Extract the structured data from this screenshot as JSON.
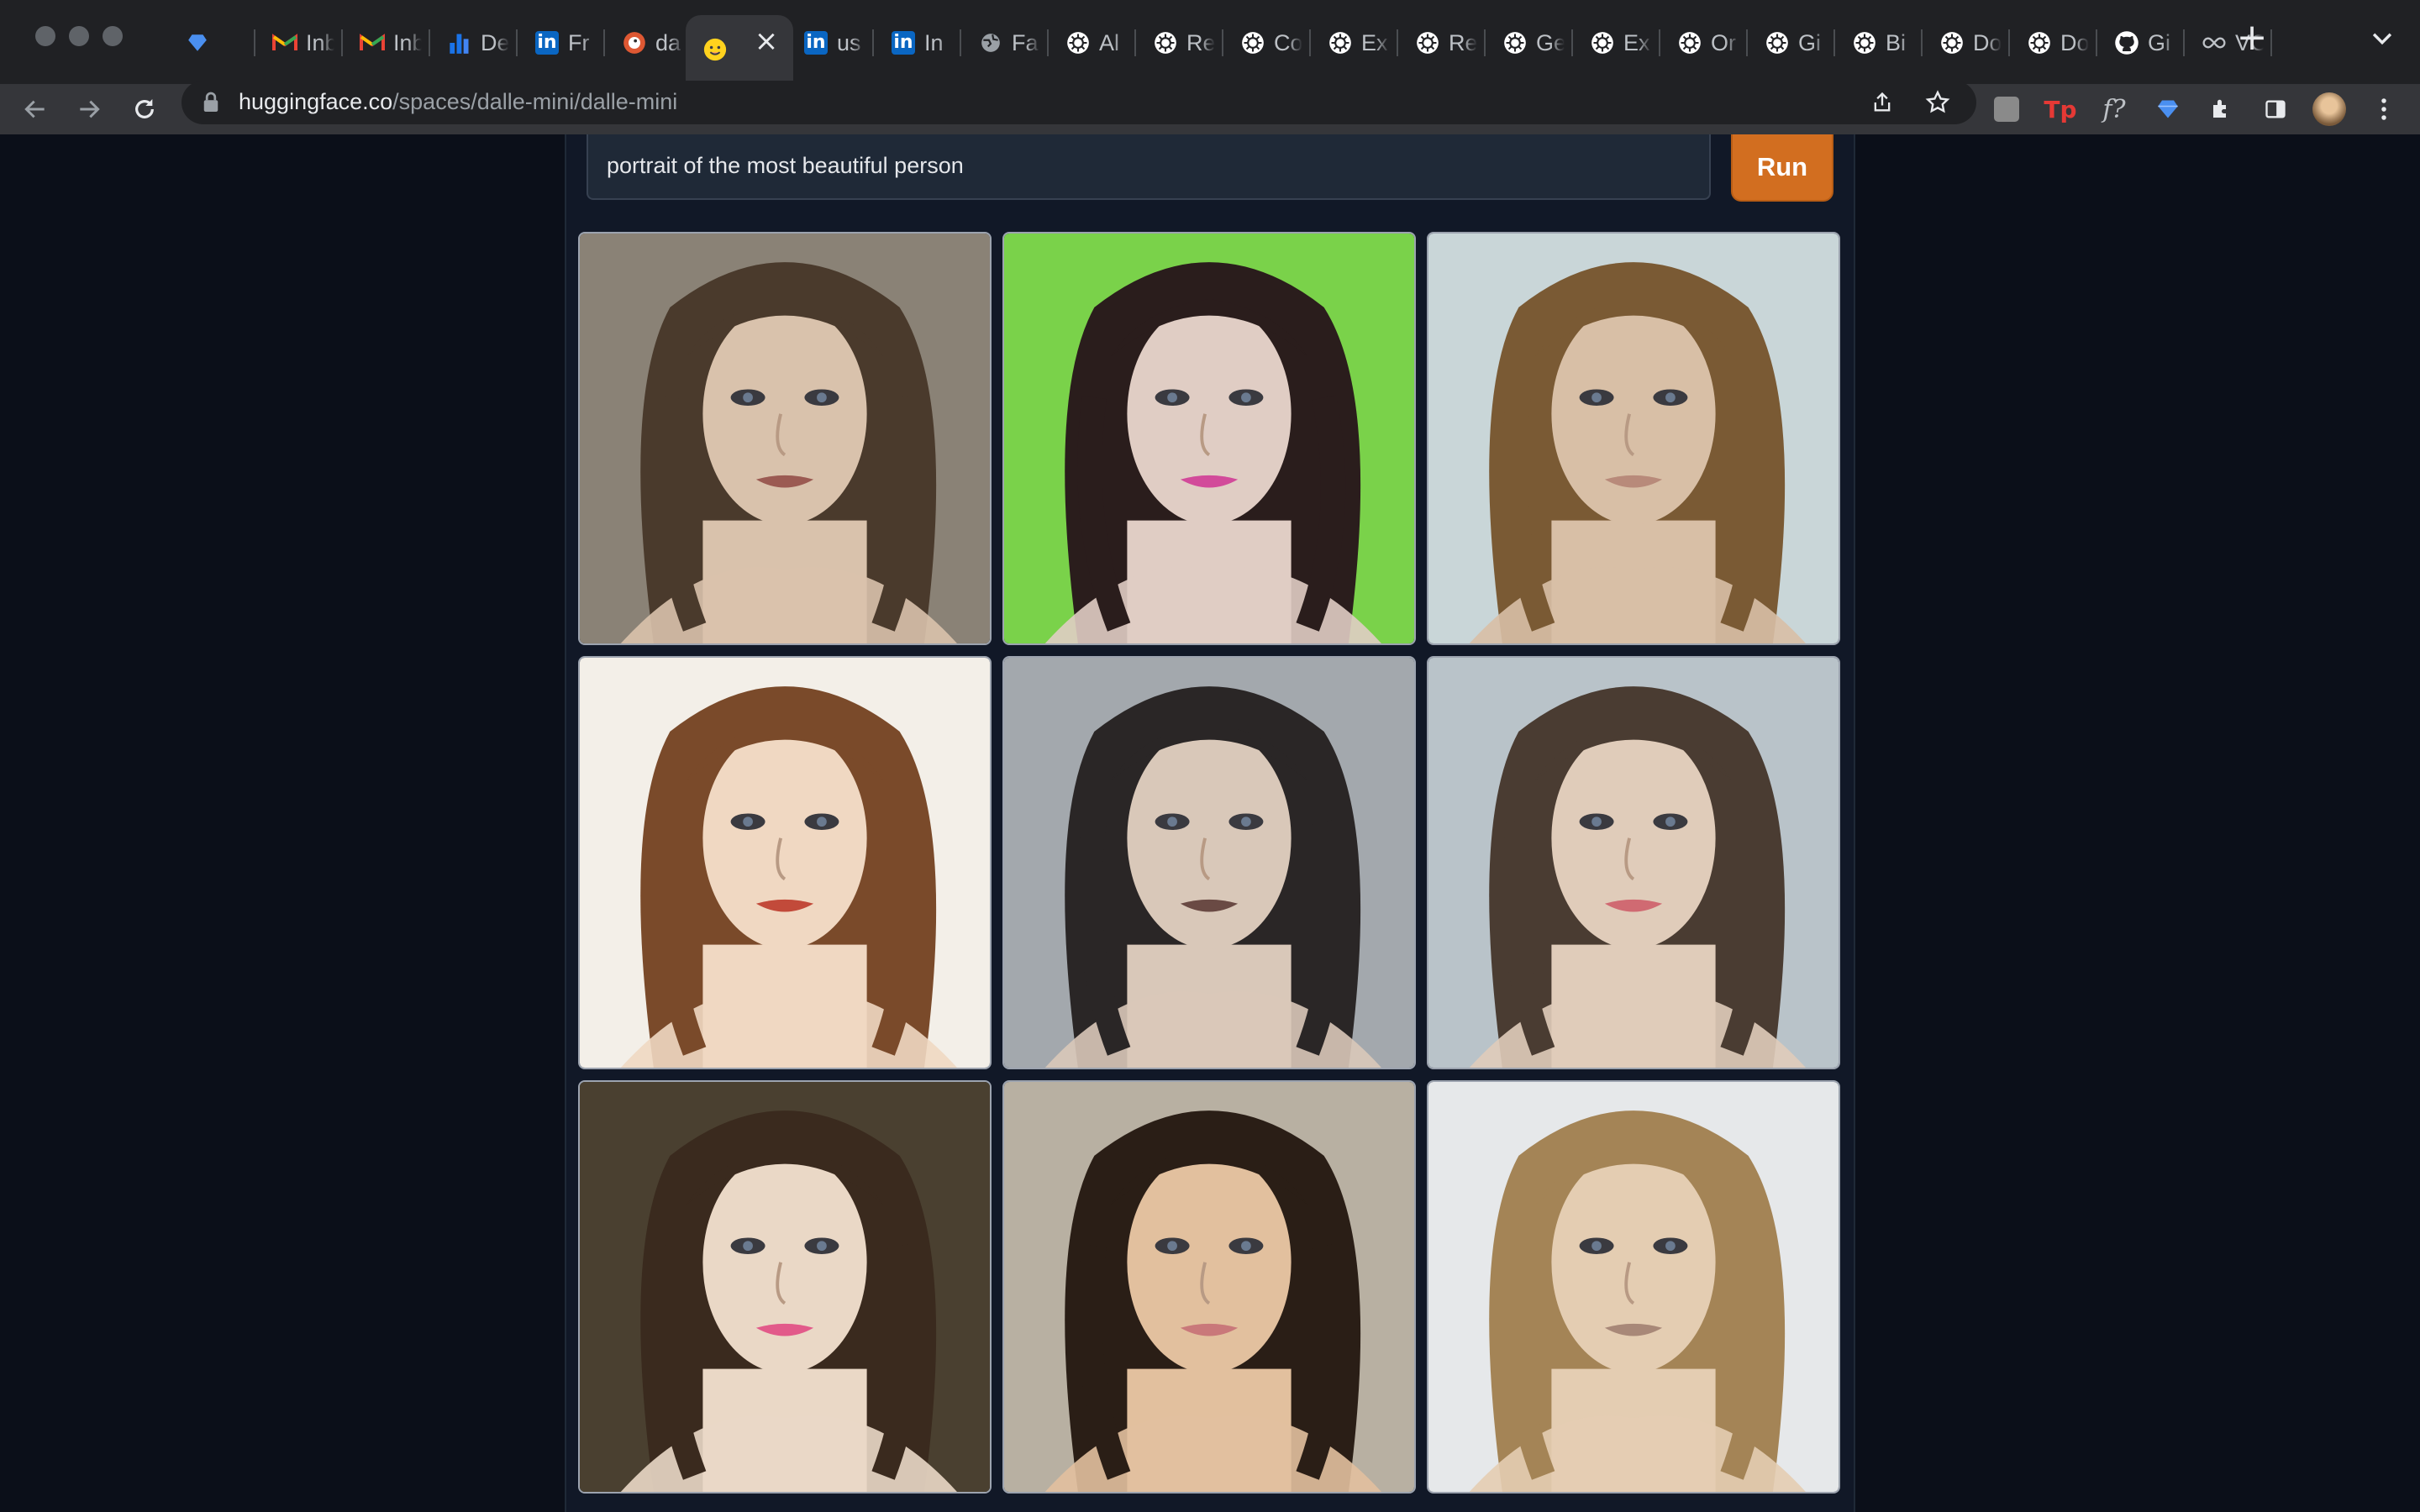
{
  "browser": {
    "tabs": [
      {
        "title": "",
        "icon": "gem-icon"
      },
      {
        "title": "Inbox",
        "icon": "gmail-icon"
      },
      {
        "title": "Inbox",
        "icon": "gmail-icon"
      },
      {
        "title": "De",
        "icon": "bar-chart-icon"
      },
      {
        "title": "Fr",
        "icon": "linkedin-icon"
      },
      {
        "title": "da",
        "icon": "duckduckgo-icon"
      },
      {
        "title": "",
        "icon": "hugging-face-icon",
        "active": true
      },
      {
        "title": "us",
        "icon": "linkedin-icon"
      },
      {
        "title": "In",
        "icon": "linkedin-icon"
      },
      {
        "title": "Fa",
        "icon": "globe-icon"
      },
      {
        "title": "Al",
        "icon": "openai-icon"
      },
      {
        "title": "Re",
        "icon": "openai-icon"
      },
      {
        "title": "Co",
        "icon": "openai-icon"
      },
      {
        "title": "Ex",
        "icon": "openai-icon"
      },
      {
        "title": "Re",
        "icon": "openai-icon"
      },
      {
        "title": "Ge",
        "icon": "openai-icon"
      },
      {
        "title": "Ex",
        "icon": "openai-icon"
      },
      {
        "title": "Or",
        "icon": "openai-icon"
      },
      {
        "title": "Gi",
        "icon": "openai-icon"
      },
      {
        "title": "Bi",
        "icon": "openai-icon"
      },
      {
        "title": "Do",
        "icon": "openai-icon"
      },
      {
        "title": "Do",
        "icon": "openai-icon"
      },
      {
        "title": "Gi",
        "icon": "github-icon"
      },
      {
        "title": "VO",
        "icon": "infinity-icon"
      }
    ],
    "url_host": "huggingface.co",
    "url_path": "/spaces/dalle-mini/dalle-mini"
  },
  "app": {
    "prompt_value": "portrait of the most beautiful person",
    "run_label": "Run",
    "colors": {
      "accent": "#d26e20",
      "background": "#0b0f19",
      "panel": "#111827"
    }
  },
  "gallery": {
    "images": [
      {
        "name": "generated-image-1",
        "bg": "#8a8276",
        "hair": "#4a3a2c",
        "skin": "#d9c2ac",
        "lips": "#9b5a52"
      },
      {
        "name": "generated-image-2",
        "bg": "#7ad24a",
        "hair": "#2a1d1c",
        "skin": "#e0cdc4",
        "lips": "#d24a9a"
      },
      {
        "name": "generated-image-3",
        "bg": "#c9d6d8",
        "hair": "#7a5a34",
        "skin": "#d8bfa6",
        "lips": "#b88a7a"
      },
      {
        "name": "generated-image-4",
        "bg": "#f3efe8",
        "hair": "#7a4a2a",
        "skin": "#f0d8c2",
        "lips": "#c24a3a"
      },
      {
        "name": "generated-image-5",
        "bg": "#a3a8ad",
        "hair": "#2a2626",
        "skin": "#d9c8b9",
        "lips": "#6a4a44"
      },
      {
        "name": "generated-image-6",
        "bg": "#b9c3c9",
        "hair": "#4a3c32",
        "skin": "#e0ccba",
        "lips": "#d06a72"
      },
      {
        "name": "generated-image-7",
        "bg": "#4a4030",
        "hair": "#3a2a1e",
        "skin": "#ead8c6",
        "lips": "#e25a8a"
      },
      {
        "name": "generated-image-8",
        "bg": "#b8b0a2",
        "hair": "#2a1e16",
        "skin": "#e2c09e",
        "lips": "#c9787a"
      },
      {
        "name": "generated-image-9",
        "bg": "#e6e8ea",
        "hair": "#a48456",
        "skin": "#e4cdb2",
        "lips": "#a88878"
      }
    ]
  }
}
